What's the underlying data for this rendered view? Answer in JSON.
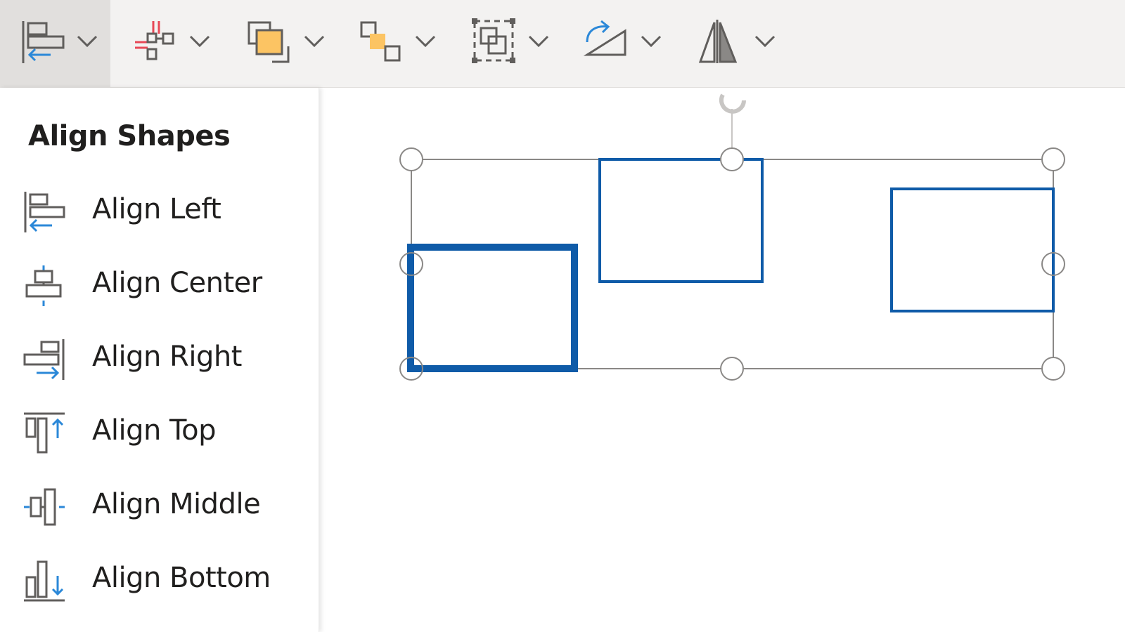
{
  "colors": {
    "toolbar_bg": "#f3f2f1",
    "active_bg": "#e1dfdd",
    "icon_gray": "#605e5c",
    "accent_blue": "#2b88d8",
    "shape_blue": "#0f5ba8",
    "orange_fill": "#fcc463",
    "red_guide": "#e74856",
    "selection_gray": "#8a8886",
    "text": "#201f1e"
  },
  "toolbar": {
    "buttons": [
      {
        "name": "align",
        "icon": "align-left-icon",
        "active": true
      },
      {
        "name": "distribute",
        "icon": "distribute-icon"
      },
      {
        "name": "bring-forward",
        "icon": "bring-forward-icon"
      },
      {
        "name": "send-backward",
        "icon": "send-backward-icon"
      },
      {
        "name": "group",
        "icon": "group-icon"
      },
      {
        "name": "rotate",
        "icon": "rotate-icon"
      },
      {
        "name": "flip",
        "icon": "flip-icon"
      }
    ]
  },
  "menu": {
    "title": "Align Shapes",
    "items": [
      {
        "label": "Align Left",
        "icon": "align-left-icon"
      },
      {
        "label": "Align Center",
        "icon": "align-center-icon"
      },
      {
        "label": "Align Right",
        "icon": "align-right-icon"
      },
      {
        "label": "Align Top",
        "icon": "align-top-icon"
      },
      {
        "label": "Align Middle",
        "icon": "align-middle-icon"
      },
      {
        "label": "Align Bottom",
        "icon": "align-bottom-icon"
      }
    ]
  }
}
